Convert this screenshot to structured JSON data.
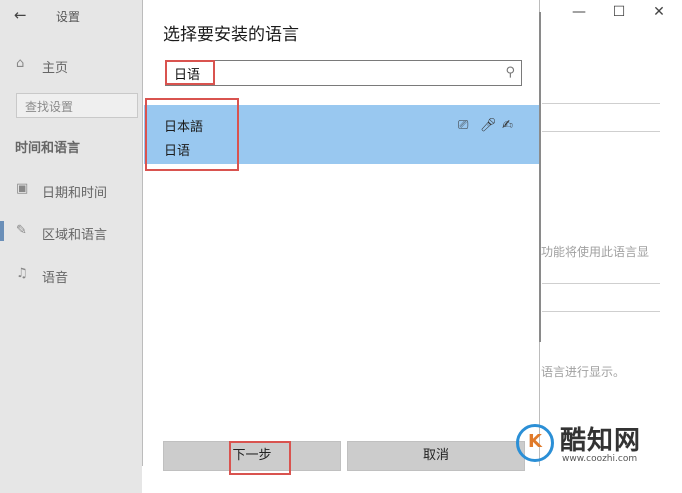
{
  "settings": {
    "window_title": "设置",
    "home_label": "主页",
    "search_placeholder": "查找设置",
    "section_heading": "时间和语言",
    "nav_items": [
      {
        "label": "日期和时间",
        "icon": "calendar-clock-icon"
      },
      {
        "label": "区域和语言",
        "icon": "region-language-icon"
      },
      {
        "label": "语音",
        "icon": "microphone-icon"
      }
    ],
    "window_controls": {
      "minimize": "—",
      "maximize": "☐",
      "close": "✕"
    },
    "bg_text_1": "功能将使用此语言显",
    "bg_text_2": "语言进行显示。"
  },
  "dialog": {
    "title": "选择要安装的语言",
    "search_value": "日语",
    "languages": [
      {
        "native": "日本語",
        "local": "日语",
        "features": [
          "display-language-icon",
          "speech-icon",
          "handwriting-icon"
        ]
      }
    ],
    "next_button": "下一步",
    "cancel_button": "取消"
  },
  "watermark": {
    "logo_letter": "K",
    "name": "酷知网",
    "url": "www.coozhi.com"
  },
  "colors": {
    "selection": "#99c8f0",
    "highlight": "#d9534f",
    "sidebar_bg": "#e6e6e6"
  }
}
